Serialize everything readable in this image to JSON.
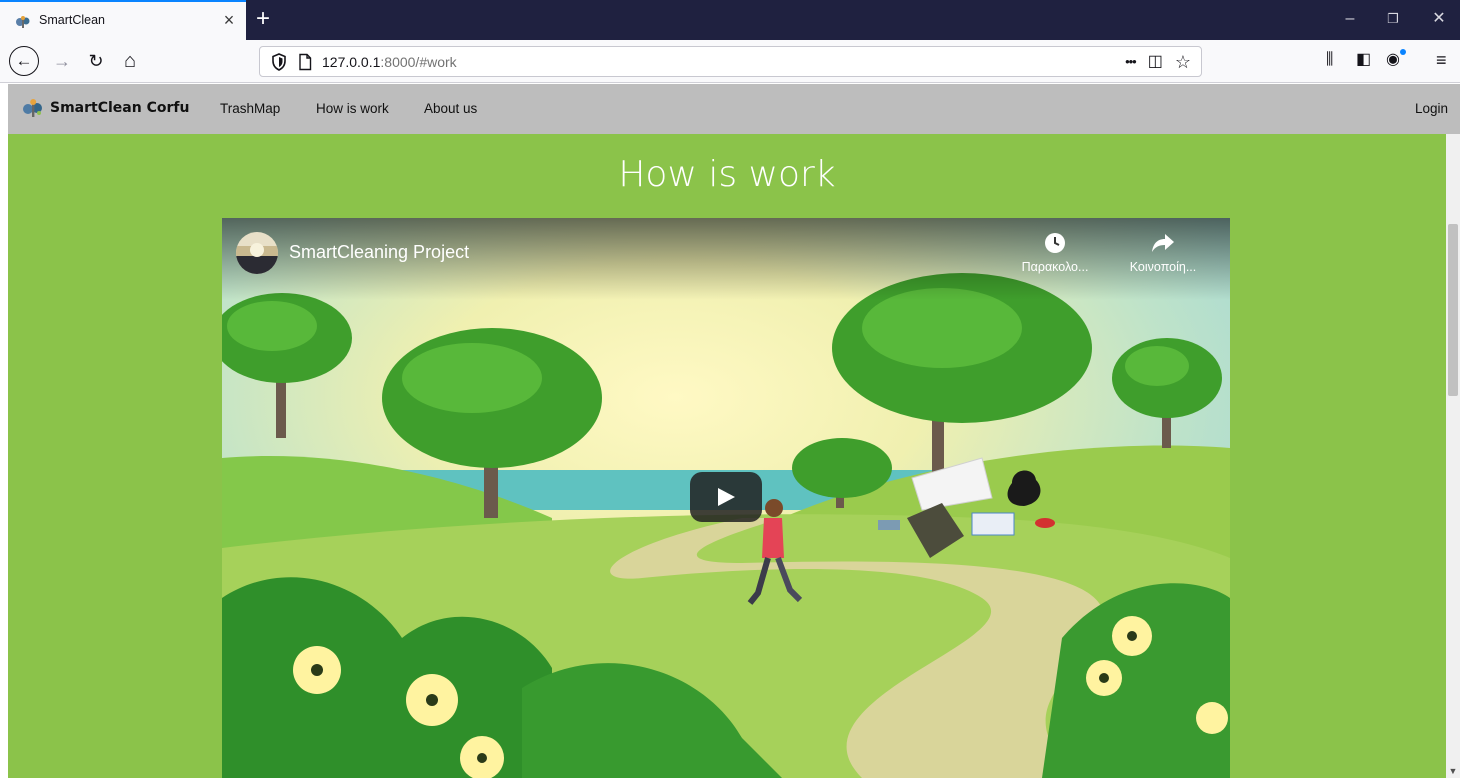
{
  "browser": {
    "tab": {
      "title": "SmartClean",
      "close_glyph": "×",
      "favicon": "smartclean-logo-icon"
    },
    "new_tab_glyph": "+",
    "window_controls": {
      "minimize": "–",
      "restore": "❐",
      "close": "✕"
    },
    "toolbar": {
      "back_glyph": "←",
      "forward_glyph": "→",
      "reload_glyph": "↻",
      "home_glyph": "⌂",
      "url_host": "127.0.0.1",
      "url_rest": ":8000/#work",
      "page_actions_glyph": "•••",
      "pocket_glyph": "◫",
      "bookmark_glyph": "☆",
      "library_glyph": "⫼",
      "sidebar_glyph": "◧",
      "account_glyph": "◉",
      "menu_glyph": "≡"
    }
  },
  "site": {
    "brand": "SmartClean Corfu",
    "nav": [
      {
        "label": "TrashMap"
      },
      {
        "label": "How is work"
      },
      {
        "label": "About us"
      }
    ],
    "login": "Login",
    "accent_color": "#8bc34a",
    "header_color": "#bdbdbd"
  },
  "main": {
    "title": "How is work",
    "video": {
      "title": "SmartCleaning Project",
      "watch_later": "Παρακολο...",
      "share": "Κοινοποίη...",
      "play_icon": "play-icon"
    }
  },
  "scrollbar": {
    "position": 0.19
  }
}
